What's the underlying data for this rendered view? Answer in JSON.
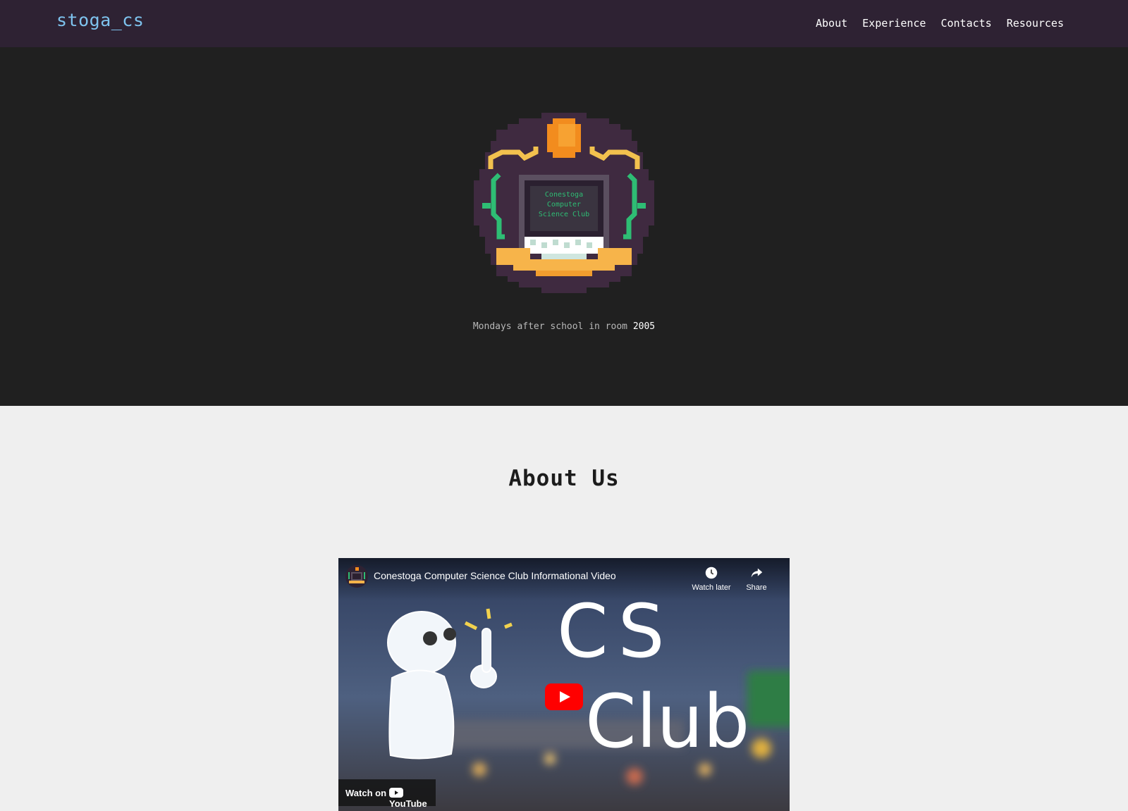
{
  "nav": {
    "brand": "stoga_cs",
    "links": [
      {
        "label": "About"
      },
      {
        "label": "Experience"
      },
      {
        "label": "Contacts"
      },
      {
        "label": "Resources"
      }
    ]
  },
  "hero": {
    "logo_lines": [
      "Conestoga",
      "Computer",
      "Science Club"
    ],
    "meeting_text": "Mondays after school in room ",
    "room": "2005"
  },
  "about": {
    "title": "About Us",
    "video": {
      "title": "Conestoga Computer Science Club Informational Video",
      "watch_later": "Watch later",
      "share": "Share",
      "watch_on": "Watch on",
      "youtube": "YouTube",
      "thumb_text_1": "CS",
      "thumb_text_2": "Club"
    }
  },
  "colors": {
    "navbar": "#2e2233",
    "brand": "#7ec3ee",
    "hero_bg": "#202020",
    "about_bg": "#efefef",
    "logo_purple": "#3f2a40",
    "logo_orange": "#f28c1e",
    "logo_gold": "#f2c14e",
    "logo_green": "#2ebd74",
    "youtube_red": "#ff0000"
  }
}
